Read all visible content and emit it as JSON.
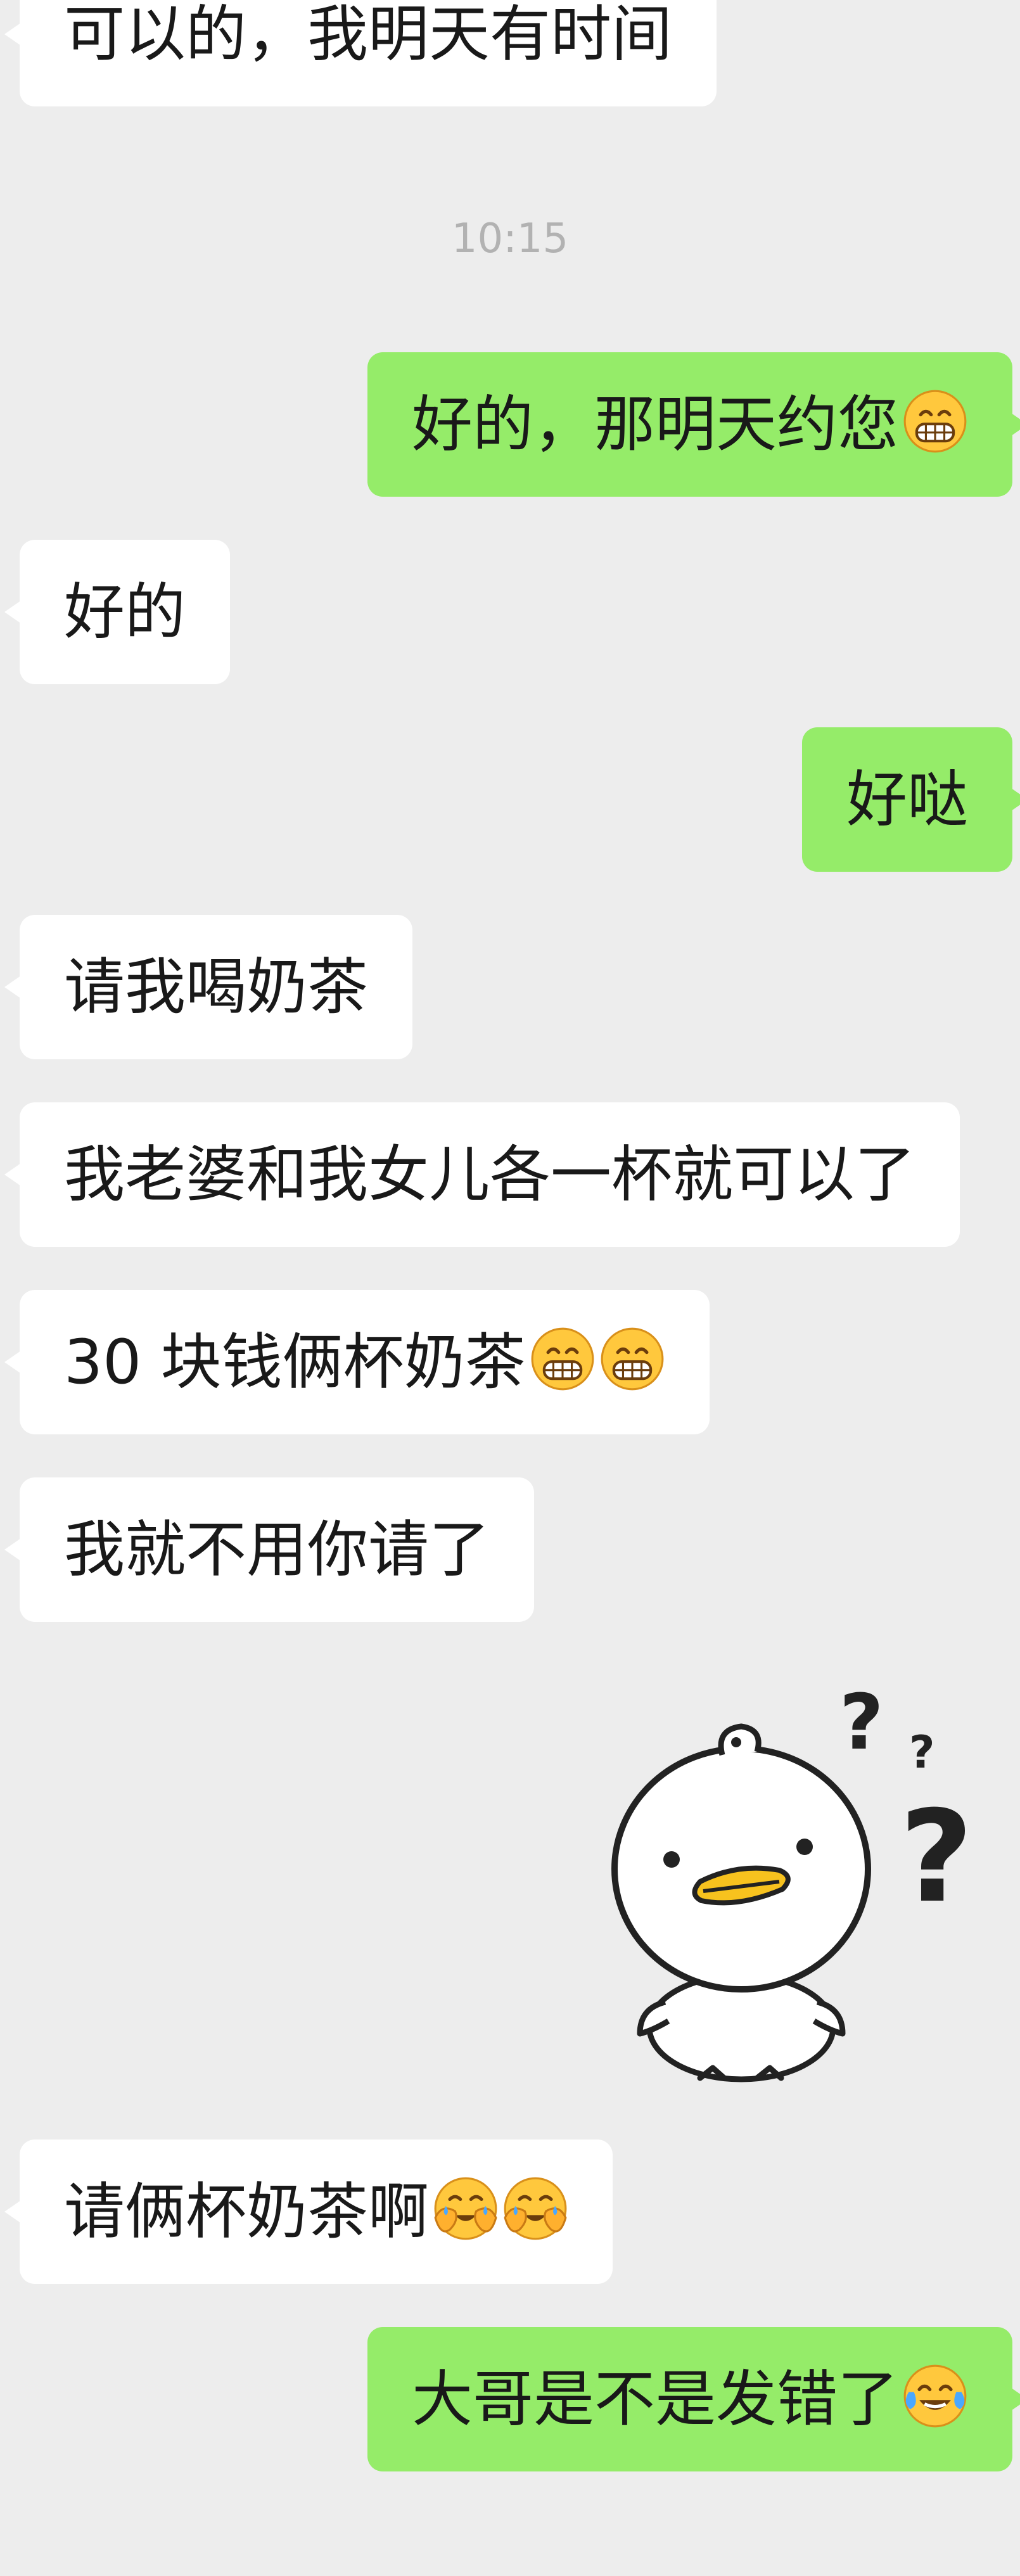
{
  "chat": {
    "timestamp": "10:15",
    "messages": [
      {
        "from": "in",
        "text": "可以的，我明天有时间"
      },
      {
        "from": "out",
        "text": "好的，那明天约您",
        "emoji": [
          "grin-icon"
        ]
      },
      {
        "from": "in",
        "text": "好的"
      },
      {
        "from": "out",
        "text": "好哒"
      },
      {
        "from": "in",
        "text": "请我喝奶茶"
      },
      {
        "from": "in",
        "text": "我老婆和我女儿各一杯就可以了"
      },
      {
        "from": "in",
        "text": "30 块钱俩杯奶茶",
        "emoji": [
          "grin-icon",
          "grin-icon"
        ]
      },
      {
        "from": "in",
        "text": "我就不用你请了"
      },
      {
        "from": "in",
        "sticker": "confused-duck-sticker"
      },
      {
        "from": "in",
        "text": "请俩杯奶茶啊",
        "emoji": [
          "facepalm-cry-icon",
          "facepalm-cry-icon"
        ]
      },
      {
        "from": "out",
        "text": "大哥是不是发错了",
        "emoji": [
          "tears-of-joy-icon"
        ]
      }
    ]
  },
  "colors": {
    "background": "#ededed",
    "incoming_bubble": "#ffffff",
    "outgoing_bubble": "#95ec69",
    "timestamp_text": "#b2b2b2",
    "emoji_yellow": "#ffc83d",
    "sticker_beak": "#f7c21e"
  }
}
